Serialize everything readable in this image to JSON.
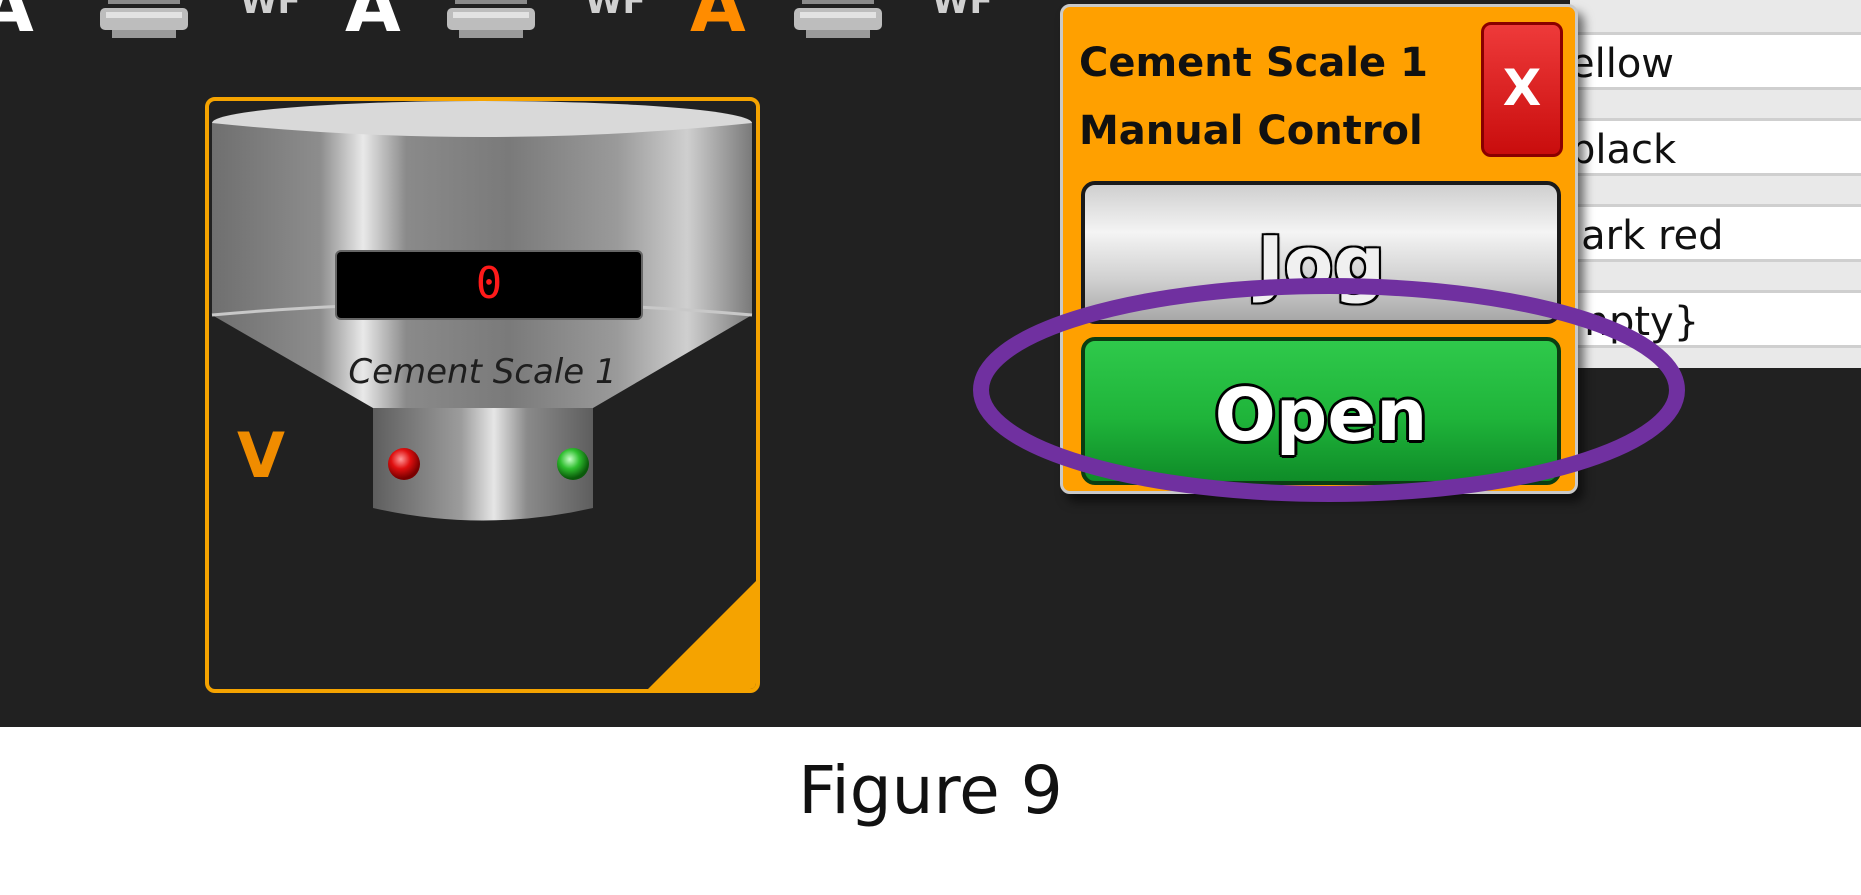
{
  "top_strip": {
    "mode_letters": [
      "A",
      "A",
      "A"
    ],
    "wf_labels": [
      "WF",
      "WF",
      "WF"
    ]
  },
  "scale_panel": {
    "weight_value": "0",
    "name": "Cement Scale 1",
    "valve_letter": "V",
    "status_lights": [
      "red",
      "green"
    ]
  },
  "property_list": {
    "items": [
      "ellow",
      "black",
      "lark red",
      "mpty}"
    ]
  },
  "manual_control": {
    "title_line1": "Cement Scale 1",
    "title_line2": "Manual Control",
    "close_label": "X",
    "jog_label": "Jog",
    "open_label": "Open"
  },
  "caption": "Figure 9",
  "colors": {
    "accent": "#ffa000",
    "highlight": "#7030a0",
    "open_green": "#1fb43a",
    "close_red": "#d41414"
  }
}
